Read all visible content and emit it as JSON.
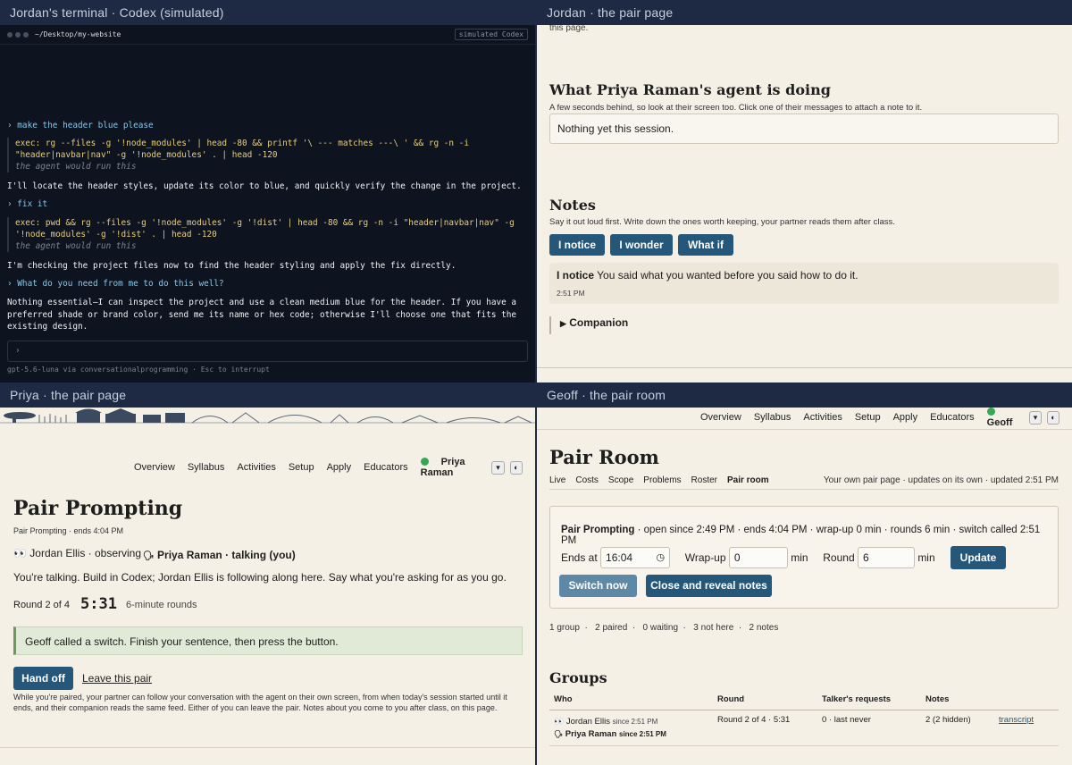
{
  "jordan_terminal": {
    "window_title": "Jordan's terminal · Codex (simulated)",
    "path": "~/Desktop/my-website",
    "badge": "simulated Codex",
    "turns": [
      {
        "user": "› make the header blue please",
        "exec1": "exec: rg --files -g '!node_modules' | head -80 && printf '\\ --- matches ---\\ ' && rg -n -i",
        "exec2": "\"header|navbar|nav\" -g '!node_modules' . | head -120",
        "note": "the agent would run this",
        "answer": "I'll locate the header styles, update its color to blue, and quickly verify the change in the project."
      },
      {
        "user": "› fix it",
        "exec1": "exec: pwd && rg --files -g '!node_modules' -g '!dist' | head -80 && rg -n -i \"header|navbar|nav\" -g",
        "exec2": "'!node_modules' -g '!dist' . | head -120",
        "note": "the agent would run this",
        "answer": "I'm checking the project files now to find the header styling and apply the fix directly."
      },
      {
        "user": "› What do you need from me to do this well?",
        "answer": "Nothing essential—I can inspect the project and use a clean medium blue for the header. If you have a preferred shade or brand color, send me its name or hex code; otherwise I'll choose one that fits the existing design."
      }
    ],
    "prompt": "›",
    "footer": "gpt-5.6-luna via conversationalprogramming  ·  Esc to interrupt"
  },
  "jordan_page": {
    "window_title": "Jordan · the pair page",
    "top_fragment": "this page.",
    "agent_heading": "What Priya Raman's agent is doing",
    "agent_sub": "A few seconds behind, so look at their screen too. Click one of their messages to attach a note to it.",
    "agent_box": "Nothing yet this session.",
    "notes_heading": "Notes",
    "notes_sub": "Say it out loud first. Write down the ones worth keeping, your partner reads them after class.",
    "note_buttons": [
      "I notice",
      "I wonder",
      "What if"
    ],
    "note_tag": "I notice",
    "note_text": "You said what you wanted before you said how to do it.",
    "note_time": "2:51 PM",
    "companion": "Companion"
  },
  "priya_page": {
    "window_title": "Priya · the pair page",
    "nav": [
      "Overview",
      "Syllabus",
      "Activities",
      "Setup",
      "Apply",
      "Educators"
    ],
    "user": "Priya Raman",
    "title": "Pair Prompting",
    "subtitle": "Pair Prompting · ends 4:04 PM",
    "observer": "Jordan Ellis · observing",
    "talker": "Priya Raman · talking (you)",
    "instruction": "You're talking. Build in Codex; Jordan Ellis is following along here. Say what you're asking for as you go.",
    "round": "Round 2 of 4",
    "timer": "5:31",
    "round_len": "6-minute rounds",
    "alert": "Geoff called a switch. Finish your sentence, then press the button.",
    "handoff": "Hand off",
    "leave": "Leave this pair",
    "footnote": "While you're paired, your partner can follow your conversation with the agent on their own screen, from when today's session started until it ends, and their companion reads the same feed. Either of you can leave the pair. Notes about you come to you after class, on this page."
  },
  "geoff_page": {
    "window_title": "Geoff · the pair room",
    "nav": [
      "Overview",
      "Syllabus",
      "Activities",
      "Setup",
      "Apply",
      "Educators"
    ],
    "user": "Geoff",
    "title": "Pair Room",
    "tabs": [
      "Live",
      "Costs",
      "Scope",
      "Problems",
      "Roster",
      "Pair room"
    ],
    "tabs_right": "Your own pair page · updates on its own · updated 2:51 PM",
    "session_bold": "Pair Prompting",
    "session_rest": " · open since 2:49 PM · ends 4:04 PM · wrap-up 0 min · rounds 6 min · switch called 2:51 PM",
    "ends_label": "Ends at",
    "ends_value": "16:04",
    "wrap_label": "Wrap-up",
    "wrap_value": "0",
    "round_label": "Round",
    "round_value": "6",
    "min": "min",
    "update": "Update",
    "switch_now": "Switch now",
    "close_reveal": "Close and reveal notes",
    "stats": [
      "1 group",
      "2 paired",
      "0 waiting",
      "3 not here",
      "2 notes"
    ],
    "groups_heading": "Groups",
    "columns": [
      "Who",
      "Round",
      "Talker's requests",
      "Notes"
    ],
    "row": {
      "member1": "Jordan Ellis",
      "since1": "since 2:51 PM",
      "member2": "Priya Raman",
      "since2": "since 2:51 PM",
      "round": "Round 2 of 4 · 5:31",
      "requests": "0 · last never",
      "notes": "2 (2 hidden)",
      "link": "transcript"
    }
  }
}
